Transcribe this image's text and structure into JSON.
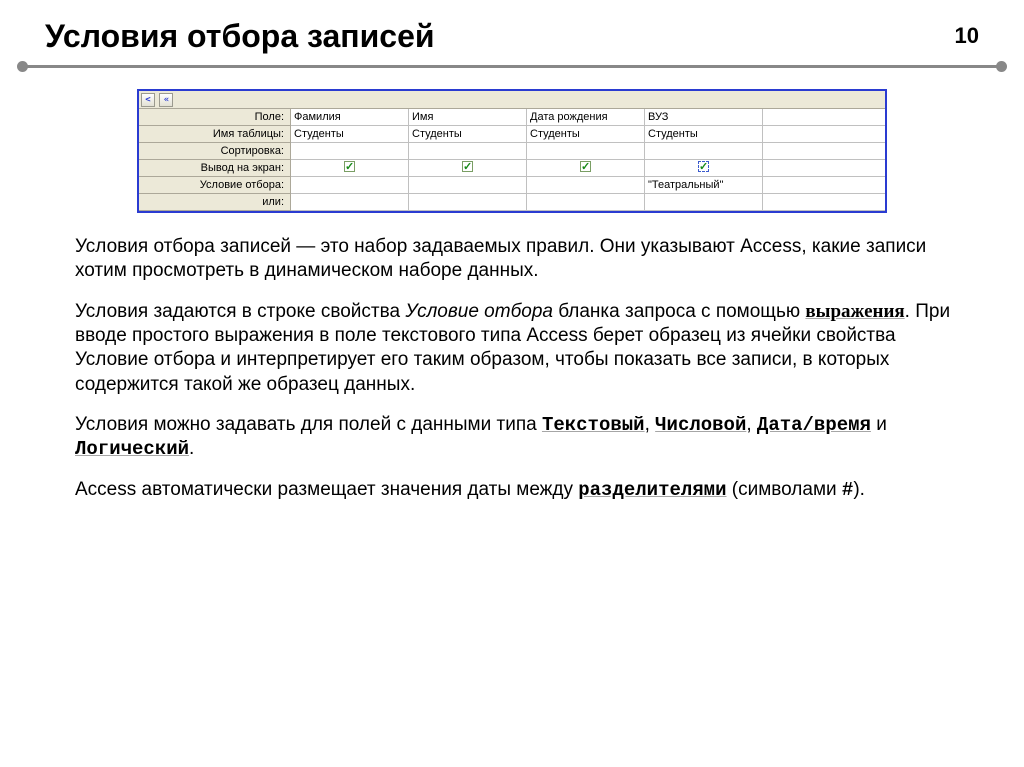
{
  "header": {
    "title": "Условия отбора записей",
    "page": "10"
  },
  "grid": {
    "props": [
      "Поле:",
      "Имя таблицы:",
      "Сортировка:",
      "Вывод на экран:",
      "Условие отбора:",
      "или:"
    ],
    "row_field": [
      "Фамилия",
      "Имя",
      "Дата рождения",
      "ВУЗ",
      ""
    ],
    "row_table": [
      "Студенты",
      "Студенты",
      "Студенты",
      "Студенты",
      ""
    ],
    "row_sort": [
      "",
      "",
      "",
      "",
      ""
    ],
    "row_criteria": [
      "",
      "",
      "",
      "\"Театральный\"",
      ""
    ],
    "row_or": [
      "",
      "",
      "",
      "",
      ""
    ]
  },
  "nav": {
    "left": "<",
    "all": "«"
  },
  "text": {
    "p1a": "Условия отбора записей — это набор задаваемых правил. Они указывают Access, какие записи хотим просмотреть в динамическом наборе данных.",
    "p2a": "Условия задаются в строке свойства ",
    "p2b": "Условие отбора",
    "p2c": " бланка запроса с помощью ",
    "p2d": "выражения",
    "p2e": ". При  вводе простого выражения в поле текстового типа Access берет образец из ячейки свойства Условие отбора и интерпретирует его таким образом, чтобы показать все записи, в которых содержится такой же образец данных.",
    "p3a": "Условия можно задавать для полей с данными типа ",
    "p3b": "Текстовый",
    "p3c": ", ",
    "p3d": "Числовой",
    "p3e": ", ",
    "p3f": "Дата/время",
    "p3g": " и ",
    "p3h": "Логический",
    "p3i": ".",
    "p4a": "Access автоматически размещает значения даты между ",
    "p4b": "разделителями",
    "p4c": " (символами ",
    "p4d": "#",
    "p4e": ")."
  }
}
